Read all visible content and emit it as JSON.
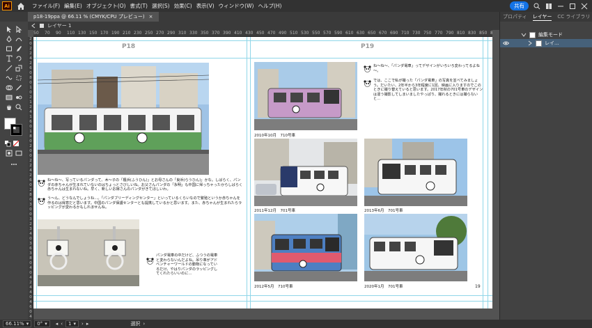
{
  "menubar": {
    "items": [
      "ファイル(F)",
      "編集(E)",
      "オブジェクト(O)",
      "書式(T)",
      "選択(S)",
      "効果(C)",
      "表示(V)",
      "ウィンドウ(W)",
      "ヘルプ(H)"
    ],
    "logo": "Ai",
    "share_label": "共有"
  },
  "document_tab": {
    "title": "p18-19ppa @ 66.11 % (CMYK/CPU プレビュー)",
    "close": "×"
  },
  "layer_bar": {
    "label": "レイヤー 1"
  },
  "ruler_h": [
    "50",
    "70",
    "90",
    "110",
    "130",
    "150",
    "170",
    "190",
    "210",
    "230",
    "250",
    "270",
    "290",
    "310",
    "330",
    "350",
    "370",
    "390",
    "410",
    "430",
    "450",
    "470",
    "490",
    "510",
    "530",
    "550",
    "570",
    "590",
    "610",
    "630",
    "650",
    "670",
    "690",
    "710",
    "730",
    "750",
    "770",
    "790",
    "810",
    "830",
    "850",
    "870"
  ],
  "ruler_v": [
    "2",
    "0",
    "2",
    "2",
    "4",
    "2",
    "6",
    "0",
    "8",
    "0",
    "1",
    "0",
    "2",
    "1",
    "2",
    "4",
    "1",
    "6",
    "0",
    "1",
    "8",
    "0",
    "2",
    "0",
    "0",
    "2",
    "2",
    "4",
    "2",
    "6",
    "0",
    "2",
    "8",
    "0",
    "3",
    "0",
    "0",
    "3",
    "2",
    "3",
    "4",
    "0",
    "3",
    "6",
    "3",
    "8",
    "0",
    "4",
    "0",
    "4",
    "2",
    "4",
    "4",
    "0",
    "4",
    "6",
    "0",
    "4",
    "8",
    "0"
  ],
  "spread": {
    "left_page_label": "P18",
    "right_page_label": "P19",
    "left_paragraph_1": "ね～ね～、写っているパンダって、木～子の「楓浜(ふうひん)」とお母さんの「良浜(らうひん)」かな。しばらく、パンダの赤ちゃんが生まれていないのはちょっとさびしいね。お父さんパンダの「永明」も中国に帰っちゃったからしばらく赤ちゃんは生まれないね。早く、新しいお嫁さんのパンダがきてほしいわ。",
    "left_paragraph_2": "う～ん、どうなんでしょうね…。「パンダブリーディングセンター」といっているくらいなので繁殖というか赤ちゃんを作るのは得意だと思います。中国のパンダ保護センターとも提携しているかと思います。また、赤ちゃんが生まれたらラッピングが変わるかもしれませんね。",
    "left_paragraph_3": "パンダ電車の中だけど、ふつうの電車と変わらないんだよね。吊り革がアドベンチャーワールドの動物になっているだけ。やはりパンダのラッピングしてくれたらいいのに…",
    "right_paragraph_1": "ね～ね～、「パンダ電車」ってデザインがいろいろ変わってるよね～。",
    "right_paragraph_2": "では、ここで私が撮った「パンダ電車」の写真を並べてみましょう。だいたい、2年半から3年程度に1回、映画に入りますのでこのときに撮り替えていると思います。2017年秋の701号車のデザインは違う撮影してしまいましたやっぱり、撮れるときには撮らないと…",
    "captions": [
      "2010年10月　710号車",
      "2011年12月　701号車",
      "2013年6月　701号車",
      "2012年5月　710号車",
      "2020年1月　701号車"
    ],
    "page_number": "19"
  },
  "panel": {
    "tabs": [
      "プロパティ",
      "レイヤー",
      "CC ライブラリ"
    ],
    "active_tab": "レイヤー",
    "rows": [
      {
        "label": "編集モード"
      },
      {
        "label": "レイ..."
      }
    ]
  },
  "statusbar": {
    "zoom": "66.11%",
    "rotation": "0°",
    "artboard": "1",
    "tool": "選択"
  },
  "colors": {
    "menubar_bg": "#323232",
    "accent": "#1473e6",
    "guide": "#8fd6e8",
    "selected_layer": "#46617a"
  }
}
